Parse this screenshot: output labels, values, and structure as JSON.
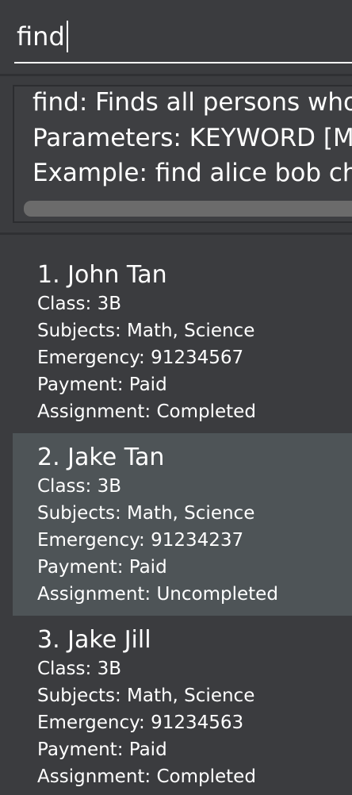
{
  "command": {
    "value": "find"
  },
  "result": {
    "lines": [
      "find: Finds all persons whose",
      "Parameters: KEYWORD [MO",
      "Example: find alice bob char"
    ]
  },
  "persons": [
    {
      "title": "1. John Tan",
      "class": "Class: 3B",
      "subjects": "Subjects: Math, Science",
      "emergency": "Emergency: 91234567",
      "payment": "Payment: Paid",
      "assignment": "Assignment: Completed"
    },
    {
      "title": "2. Jake Tan",
      "class": "Class: 3B",
      "subjects": "Subjects: Math, Science",
      "emergency": "Emergency: 91234237",
      "payment": "Payment: Paid",
      "assignment": "Assignment: Uncompleted"
    },
    {
      "title": "3. Jake Jill",
      "class": "Class: 3B",
      "subjects": "Subjects: Math, Science",
      "emergency": "Emergency: 91234563",
      "payment": "Payment: Paid",
      "assignment": "Assignment: Completed"
    }
  ],
  "colors": {
    "background": "#3b3c3f",
    "selected_card": "#4e5457",
    "text": "#ffffff",
    "scrollbar": "#6b6b6b"
  }
}
